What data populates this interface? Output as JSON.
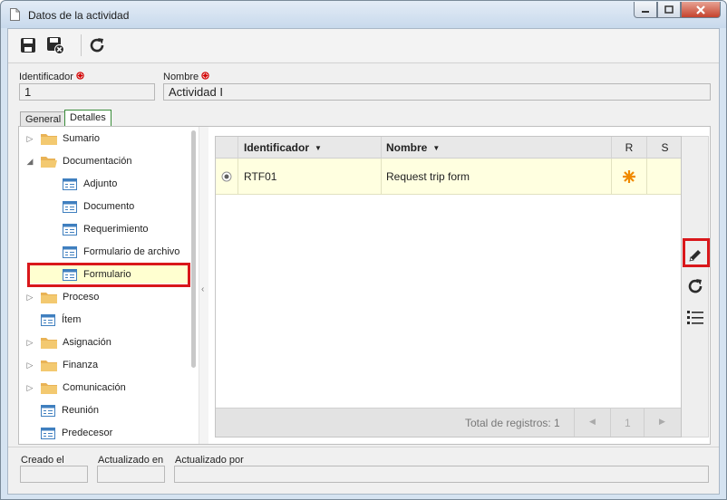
{
  "window": {
    "title": "Datos de la actividad"
  },
  "toolbar": {
    "save": "save-icon",
    "save_close": "save-close-icon",
    "refresh": "refresh-icon"
  },
  "form": {
    "identificador_label": "Identificador",
    "identificador_value": "1",
    "nombre_label": "Nombre",
    "nombre_value": "Actividad I"
  },
  "tabs": [
    {
      "label": "General"
    },
    {
      "label": "Detalles"
    }
  ],
  "tree": {
    "items": [
      {
        "label": "Sumario"
      },
      {
        "label": "Documentación"
      },
      {
        "label": "Adjunto"
      },
      {
        "label": "Documento"
      },
      {
        "label": "Requerimiento"
      },
      {
        "label": "Formulario de archivo"
      },
      {
        "label": "Formulario"
      },
      {
        "label": "Proceso"
      },
      {
        "label": "Ítem"
      },
      {
        "label": "Asignación"
      },
      {
        "label": "Finanza"
      },
      {
        "label": "Comunicación"
      },
      {
        "label": "Reunión"
      },
      {
        "label": "Predecesor"
      }
    ]
  },
  "grid": {
    "columns": [
      "Identificador",
      "Nombre",
      "R",
      "S"
    ],
    "rows": [
      {
        "identificador": "RTF01",
        "nombre": "Request trip form"
      }
    ],
    "footer": {
      "total": "Total de registros: 1",
      "page": "1"
    }
  },
  "bottom": {
    "creado_label": "Creado el",
    "actualizado_en_label": "Actualizado en",
    "actualizado_por_label": "Actualizado por"
  },
  "colors": {
    "highlight": "#d9171b",
    "selected_row": "#ffffe0",
    "required": "#d40000"
  }
}
